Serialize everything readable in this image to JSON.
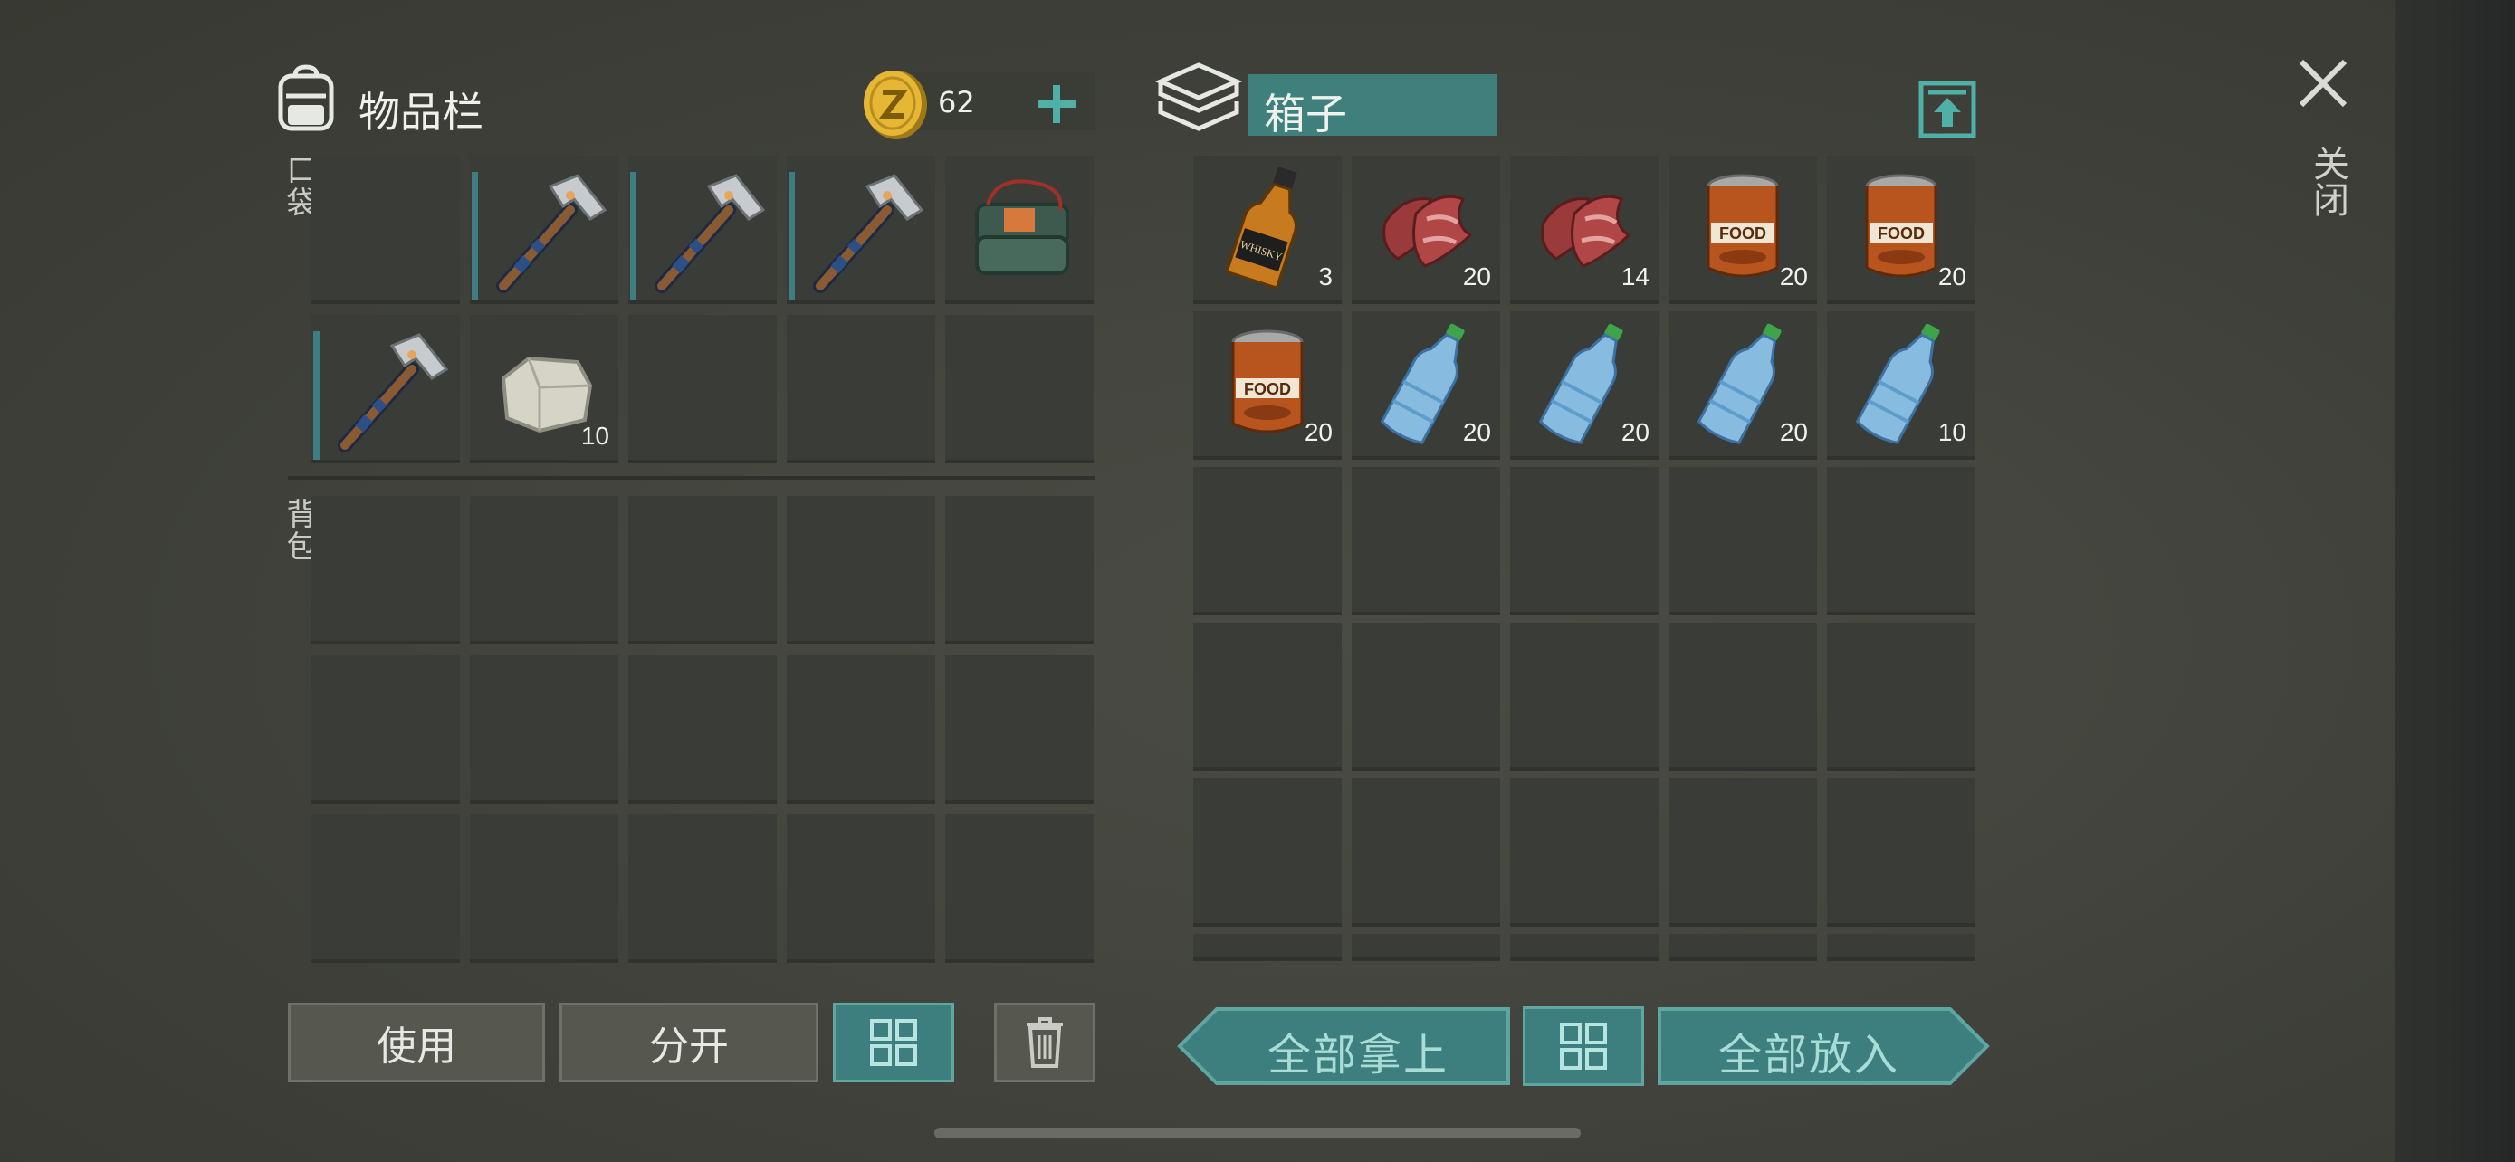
{
  "inventory": {
    "title": "物品栏",
    "coins": "62",
    "pocket_label": "口袋",
    "backpack_label": "背包",
    "pocket_slots": [
      {
        "item": "",
        "qty": ""
      },
      {
        "item": "pickaxe-icon",
        "qty": ""
      },
      {
        "item": "pickaxe-icon",
        "qty": ""
      },
      {
        "item": "pickaxe-icon",
        "qty": ""
      },
      {
        "item": "c4-explosive-icon",
        "qty": ""
      },
      {
        "item": "pickaxe-icon",
        "qty": ""
      },
      {
        "item": "stone-icon",
        "qty": "10"
      },
      {
        "item": "",
        "qty": ""
      },
      {
        "item": "",
        "qty": ""
      },
      {
        "item": "",
        "qty": ""
      }
    ]
  },
  "actions": {
    "use": "使用",
    "split": "分开"
  },
  "box": {
    "title": "箱子",
    "take_all": "全部拿上",
    "put_all": "全部放入",
    "slots": [
      {
        "item": "whiskey-icon",
        "qty": "3"
      },
      {
        "item": "raw-meat-icon",
        "qty": "20"
      },
      {
        "item": "raw-meat-icon",
        "qty": "14"
      },
      {
        "item": "canned-food-icon",
        "qty": "20"
      },
      {
        "item": "canned-food-icon",
        "qty": "20"
      },
      {
        "item": "canned-food-icon",
        "qty": "20"
      },
      {
        "item": "water-bottle-icon",
        "qty": "20"
      },
      {
        "item": "water-bottle-icon",
        "qty": "20"
      },
      {
        "item": "water-bottle-icon",
        "qty": "20"
      },
      {
        "item": "water-bottle-icon",
        "qty": "10"
      }
    ]
  },
  "close": {
    "label": "关闭"
  },
  "colors": {
    "accent_teal": "#3d7f7e",
    "slot_bg": "#3a3d37",
    "durability_bar": "#3e7e82"
  }
}
